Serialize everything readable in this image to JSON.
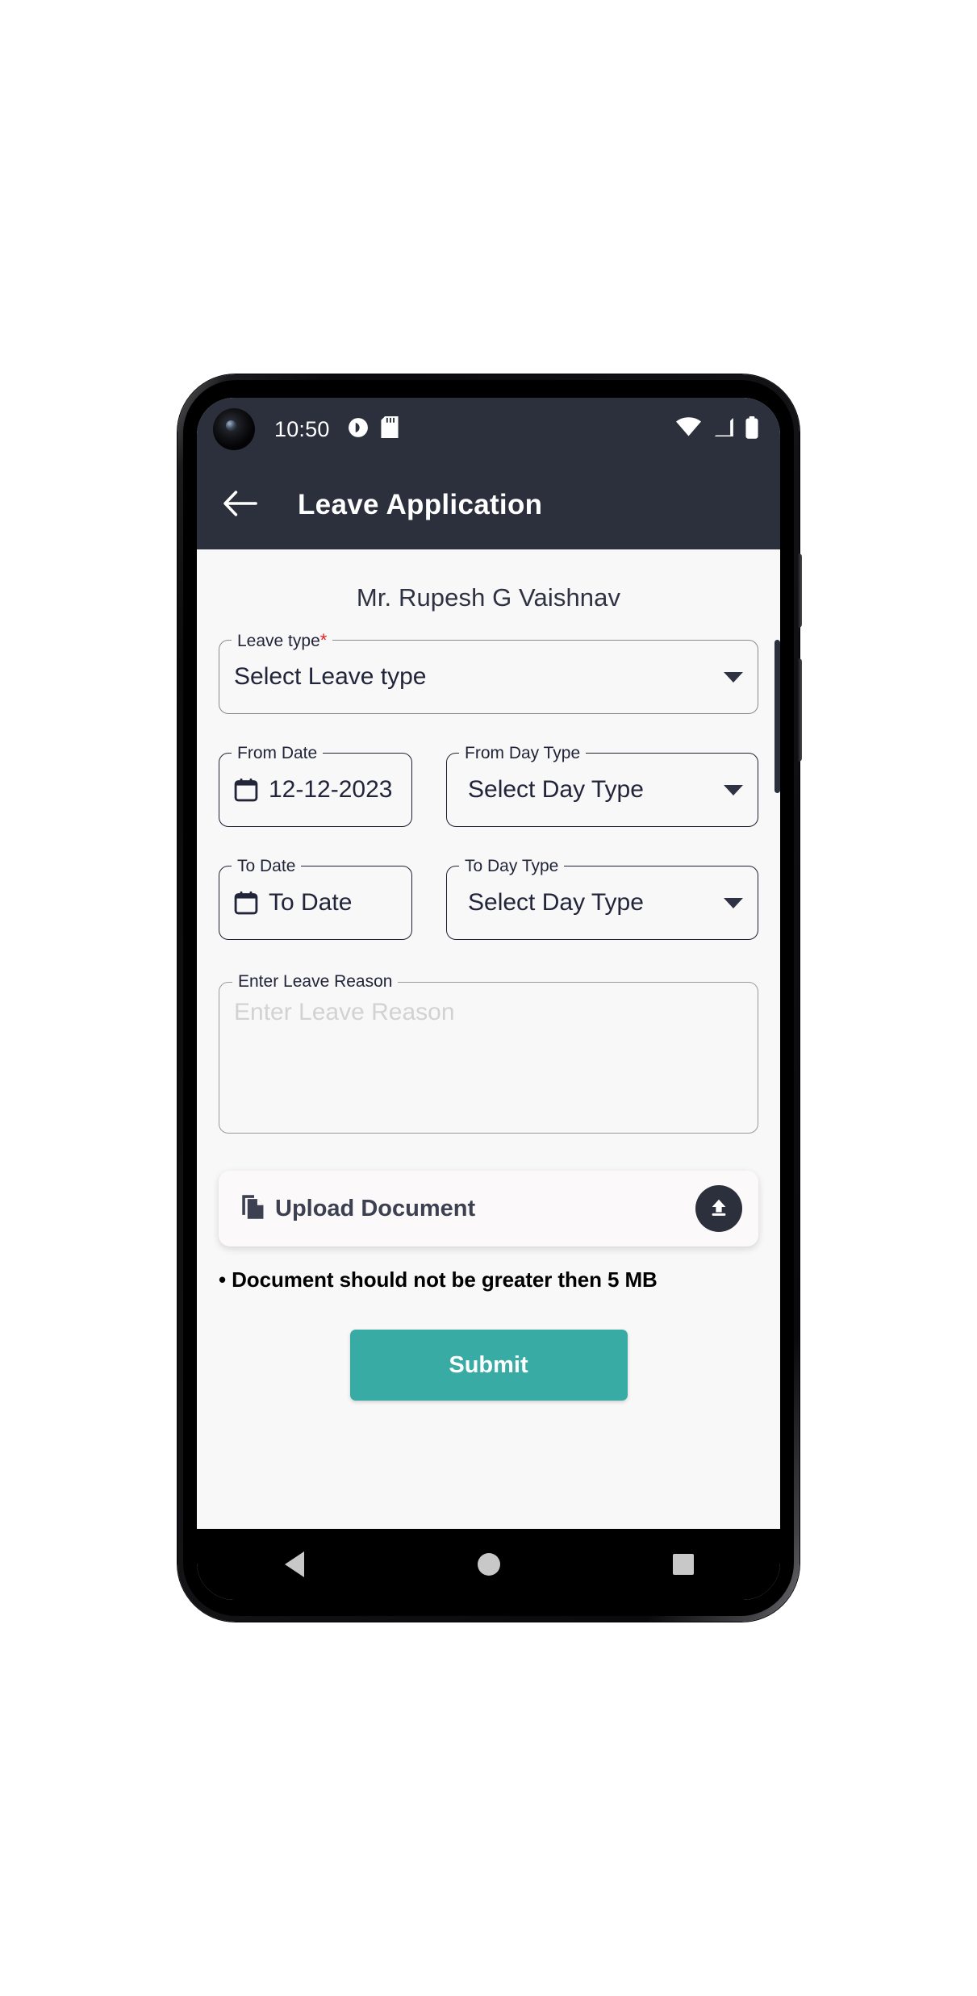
{
  "statusbar": {
    "time": "10:50",
    "notification_icons": [
      "screen-record-icon",
      "sd-card-icon"
    ],
    "right_icons": [
      "wifi-icon",
      "cellular-signal-icon",
      "battery-icon"
    ]
  },
  "appbar": {
    "back_icon": "back-arrow-icon",
    "title": "Leave Application",
    "background_color": "#2C2F3C"
  },
  "form": {
    "employee_name": "Mr. Rupesh G Vaishnav",
    "leave_type": {
      "label": "Leave type",
      "required_marker": "*",
      "value": "Select Leave type",
      "dropdown_icon": "chevron-down-icon"
    },
    "from_date": {
      "label": "From Date",
      "value": "12-12-2023",
      "icon": "calendar-icon"
    },
    "from_day_type": {
      "label": "From Day Type",
      "value": "Select Day Type",
      "dropdown_icon": "chevron-down-icon"
    },
    "to_date": {
      "label": "To Date",
      "value": "To Date",
      "icon": "calendar-icon"
    },
    "to_day_type": {
      "label": "To Day Type",
      "value": "Select Day Type",
      "dropdown_icon": "chevron-down-icon"
    },
    "leave_reason": {
      "label": "Enter Leave Reason",
      "placeholder": "Enter Leave Reason",
      "value": ""
    },
    "upload": {
      "label": "Upload Document",
      "file_icon": "document-copy-icon",
      "action_icon": "upload-arrow-icon",
      "note": "• Document should not be greater then 5 MB"
    },
    "submit_label": "Submit",
    "submit_color": "#37ABA4"
  },
  "navbar": {
    "back_label": "back-triangle-icon",
    "home_label": "home-circle-icon",
    "recents_label": "recents-square-icon"
  }
}
